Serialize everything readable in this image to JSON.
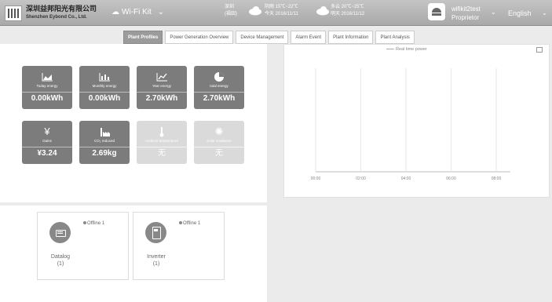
{
  "header": {
    "company_cn": "深圳益邦阳光有限公司",
    "company_en": "Shenzhen Eybond Co., Ltd.",
    "wifi_label": "Wi-Fi Kit",
    "weather_city": "深圳",
    "weather_district": "(福田)",
    "weather_today_temp": "阴雨 15℃~22℃",
    "weather_today_date": "今天 2016/11/11",
    "weather_tomorrow_temp": "多云 20℃~25℃",
    "weather_tomorrow_date": "明天 2016/11/12",
    "user_name": "wifikit2test",
    "user_role": "Proprietor",
    "language": "English"
  },
  "tabs": [
    {
      "label": "Plant Profiles",
      "active": true
    },
    {
      "label": "Power Generation Overview",
      "active": false
    },
    {
      "label": "Device Management",
      "active": false
    },
    {
      "label": "Alarm Event",
      "active": false
    },
    {
      "label": "Plant Information",
      "active": false
    },
    {
      "label": "Plant Analysis",
      "active": false
    }
  ],
  "stats": [
    {
      "label": "Today energy",
      "value": "0.00kWh",
      "icon": "area-chart-icon",
      "dim": false
    },
    {
      "label": "Monthly energy",
      "value": "0.00kWh",
      "icon": "bar-chart-icon",
      "dim": false
    },
    {
      "label": "Year energy",
      "value": "2.70kWh",
      "icon": "line-chart-icon",
      "dim": false
    },
    {
      "label": "total energy",
      "value": "2.70kWh",
      "icon": "pie-chart-icon",
      "dim": false
    },
    {
      "label": "Gains",
      "value": "¥3.24",
      "icon": "yen-icon",
      "dim": false
    },
    {
      "label": "CO₂ reduced",
      "value": "2.69kg",
      "icon": "factory-icon",
      "dim": false
    },
    {
      "label": "Ambient temperature",
      "value": "无",
      "icon": "thermometer-icon",
      "dim": true
    },
    {
      "label": "Solar irradiance",
      "value": "无",
      "icon": "sun-icon",
      "dim": true
    }
  ],
  "chart": {
    "legend": "Real time power",
    "x_ticks": [
      "00:00",
      "02:00",
      "04:00",
      "06:00",
      "08:00"
    ]
  },
  "chart_data": {
    "type": "line",
    "x": [
      "00:00",
      "02:00",
      "04:00",
      "06:00",
      "08:00"
    ],
    "series": [
      {
        "name": "Real time power",
        "values": []
      }
    ],
    "grid": true,
    "legend_placement": "top-center"
  },
  "devices": [
    {
      "name": "Datalog",
      "count": "(1)",
      "status": "Offline 1",
      "icon": "datalogger-icon"
    },
    {
      "name": "Inverter",
      "count": "(1)",
      "status": "Offline 1",
      "icon": "inverter-icon"
    }
  ]
}
